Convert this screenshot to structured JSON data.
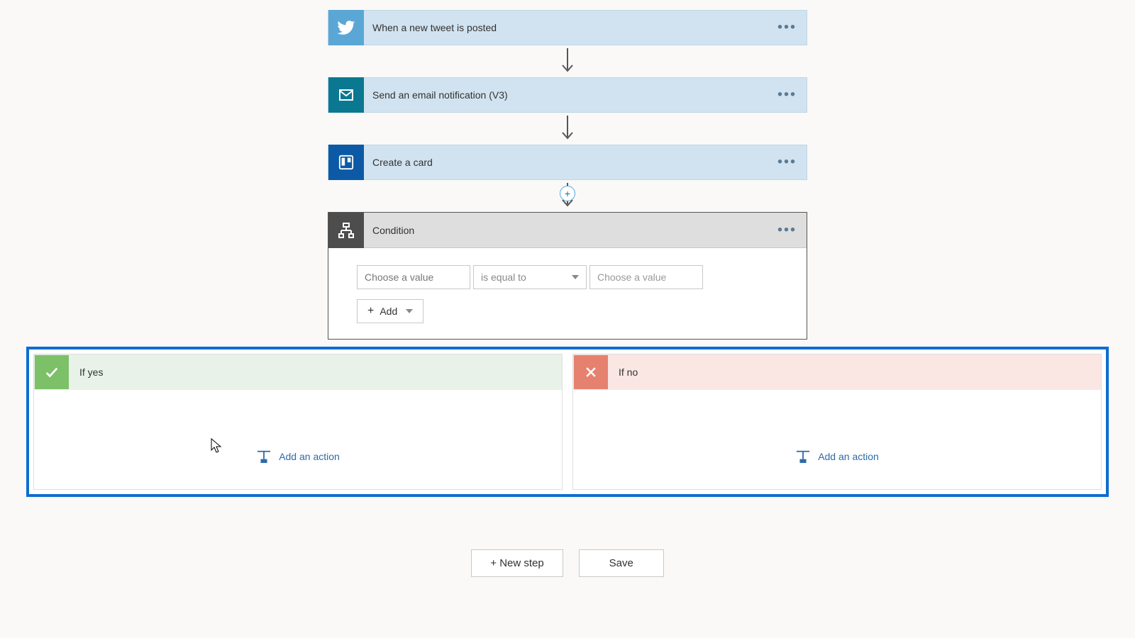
{
  "steps": {
    "twitter": "When a new tweet is posted",
    "email": "Send an email notification (V3)",
    "trello": "Create a card"
  },
  "condition": {
    "title": "Condition",
    "left_placeholder": "Choose a value",
    "operator": "is equal to",
    "right_placeholder": "Choose a value",
    "add_label": "Add"
  },
  "branches": {
    "yes_label": "If yes",
    "no_label": "If no",
    "add_action": "Add an action"
  },
  "footer": {
    "new_step": "+ New step",
    "save": "Save"
  }
}
